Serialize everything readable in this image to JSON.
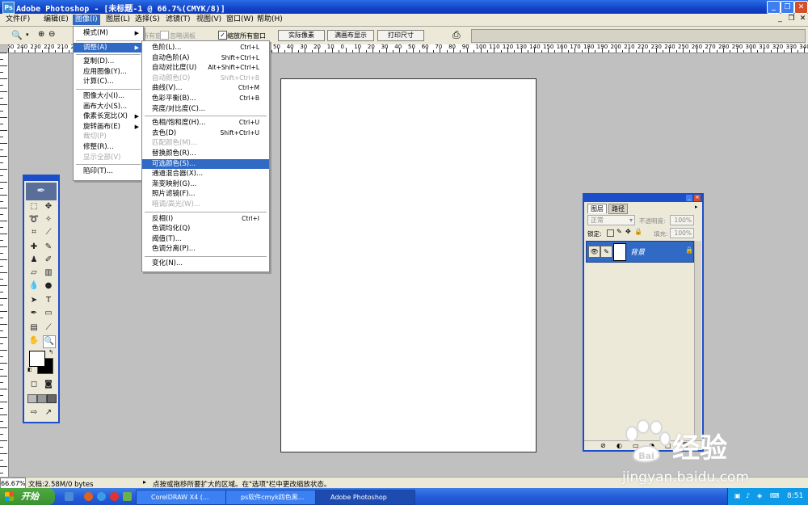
{
  "window": {
    "title": "Adobe Photoshop - [未标题-1 @ 66.7%(CMYK/8)]"
  },
  "menubar": {
    "items": [
      "文件(F)",
      "编辑(E)",
      "图像(I)",
      "图层(L)",
      "选择(S)",
      "滤镜(T)",
      "视图(V)",
      "窗口(W)",
      "帮助(H)"
    ]
  },
  "options": {
    "dim_label": "所有窗口",
    "dim_label2": "忽略调板",
    "resize_windows": "缩放所有窗口",
    "actual_pixels": "实际像素",
    "fit_screen": "满画布显示",
    "print_size": "打印尺寸"
  },
  "ruler_top_labels": [
    "250",
    "240",
    "230",
    "220",
    "210",
    "200",
    "190",
    "180",
    "170",
    "160",
    "150",
    "140",
    "130",
    "120",
    "110",
    "100",
    "90",
    "80",
    "70",
    "60",
    "50",
    "40",
    "30",
    "20",
    "10",
    "0",
    "10",
    "20",
    "30",
    "40",
    "50",
    "60",
    "70",
    "80",
    "90",
    "100",
    "110",
    "120",
    "130",
    "140",
    "150",
    "160",
    "170",
    "180",
    "190",
    "200",
    "210",
    "220",
    "230",
    "240",
    "250",
    "260",
    "270",
    "280",
    "290",
    "300",
    "310",
    "320",
    "330",
    "340",
    "350",
    "360",
    "370",
    "380",
    "390",
    "400",
    "410",
    "420",
    "430",
    "440",
    "450",
    "460",
    "470",
    "480"
  ],
  "image_menu": {
    "items": [
      {
        "label": "模式(M)",
        "submenu": true
      },
      {
        "sep": true
      },
      {
        "label": "调整(A)",
        "submenu": true,
        "highlight": true
      },
      {
        "sep": true
      },
      {
        "label": "复制(D)..."
      },
      {
        "label": "应用图像(Y)..."
      },
      {
        "label": "计算(C)..."
      },
      {
        "sep": true
      },
      {
        "label": "图像大小(I)..."
      },
      {
        "label": "画布大小(S)..."
      },
      {
        "label": "像素长宽比(X)",
        "submenu": true
      },
      {
        "label": "旋转画布(E)",
        "submenu": true
      },
      {
        "label": "裁切(P)",
        "disabled": true
      },
      {
        "label": "修整(R)..."
      },
      {
        "label": "显示全部(V)",
        "disabled": true
      },
      {
        "sep": true
      },
      {
        "label": "陷印(T)..."
      }
    ]
  },
  "adjust_menu": {
    "items": [
      {
        "label": "色阶(L)...",
        "shortcut": "Ctrl+L"
      },
      {
        "label": "自动色阶(A)",
        "shortcut": "Shift+Ctrl+L"
      },
      {
        "label": "自动对比度(U)",
        "shortcut": "Alt+Shift+Ctrl+L"
      },
      {
        "label": "自动颜色(O)",
        "shortcut": "Shift+Ctrl+B",
        "disabled": true
      },
      {
        "label": "曲线(V)...",
        "shortcut": "Ctrl+M"
      },
      {
        "label": "色彩平衡(B)...",
        "shortcut": "Ctrl+B"
      },
      {
        "label": "亮度/对比度(C)..."
      },
      {
        "sep": true
      },
      {
        "label": "色相/饱和度(H)...",
        "shortcut": "Ctrl+U"
      },
      {
        "label": "去色(D)",
        "shortcut": "Shift+Ctrl+U"
      },
      {
        "label": "匹配颜色(M)...",
        "disabled": true
      },
      {
        "label": "替换颜色(R)..."
      },
      {
        "label": "可选颜色(S)...",
        "highlight": true
      },
      {
        "label": "通道混合器(X)..."
      },
      {
        "label": "渐变映射(G)..."
      },
      {
        "label": "照片滤镜(F)..."
      },
      {
        "label": "暗调/高光(W)...",
        "disabled": true
      },
      {
        "sep": true
      },
      {
        "label": "反相(I)",
        "shortcut": "Ctrl+I"
      },
      {
        "label": "色调均化(Q)"
      },
      {
        "label": "阈值(T)..."
      },
      {
        "label": "色调分离(P)..."
      },
      {
        "sep": true
      },
      {
        "label": "变化(N)..."
      }
    ]
  },
  "layers_panel": {
    "tabs": [
      "图层",
      "路径"
    ],
    "blend_mode": "正常",
    "opacity_label": "不透明度:",
    "opacity_value": "100%",
    "lock_label": "锁定:",
    "fill_label": "填充:",
    "fill_value": "100%",
    "layer_name": "背景"
  },
  "status": {
    "zoom": "66.67%",
    "doc": "文档:2.58M/0 bytes",
    "hint": "点按或拖移所要扩大的区域。在\"选项\"栏中更改缩放状态。"
  },
  "taskbar": {
    "start": "开始",
    "tasks": [
      "CorelDRAW X4 (...",
      "ps软件cmyk四色黑...",
      "Adobe Photoshop"
    ],
    "clock": "8:51"
  },
  "watermark": {
    "brand": "经验",
    "url": "jingyan.baidu.com"
  }
}
